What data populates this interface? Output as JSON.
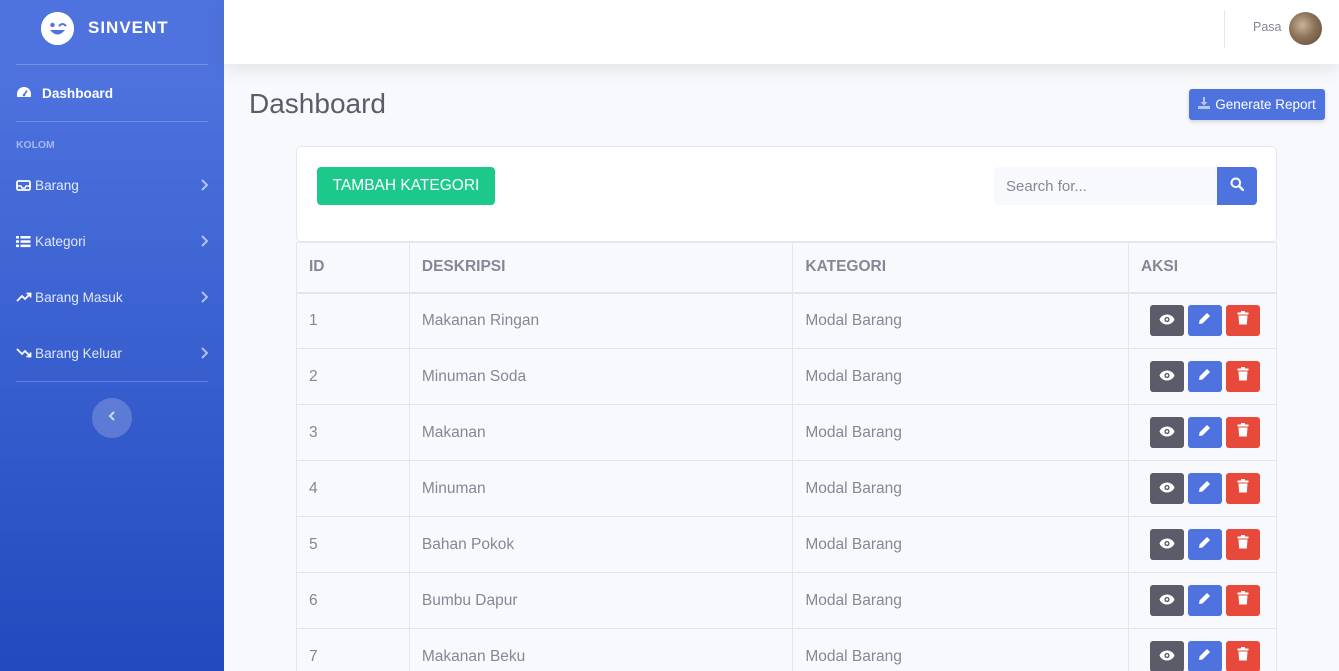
{
  "brand": {
    "name": "SINVENT",
    "icon": "laugh-wink-icon"
  },
  "sidebar": {
    "dashboard": {
      "label": "Dashboard",
      "icon": "tachometer-icon"
    },
    "heading": "KOLOM",
    "items": [
      {
        "label": "Barang",
        "icon": "inbox-icon"
      },
      {
        "label": "Kategori",
        "icon": "list-icon"
      },
      {
        "label": "Barang Masuk",
        "icon": "trend-up-icon"
      },
      {
        "label": "Barang Keluar",
        "icon": "trend-down-icon"
      }
    ],
    "toggle_icon": "chevron-left-icon"
  },
  "topbar": {
    "user_name": "Pasa"
  },
  "page": {
    "title": "Dashboard",
    "report_button": "Generate Report"
  },
  "card": {
    "add_button": "TAMBAH KATEGORI",
    "search_placeholder": "Search for..."
  },
  "table": {
    "headers": [
      "ID",
      "DESKRIPSI",
      "KATEGORI",
      "AKSI"
    ],
    "rows": [
      {
        "id": "1",
        "deskripsi": "Makanan Ringan",
        "kategori": "Modal Barang"
      },
      {
        "id": "2",
        "deskripsi": "Minuman Soda",
        "kategori": "Modal Barang"
      },
      {
        "id": "3",
        "deskripsi": "Makanan",
        "kategori": "Modal Barang"
      },
      {
        "id": "4",
        "deskripsi": "Minuman",
        "kategori": "Modal Barang"
      },
      {
        "id": "5",
        "deskripsi": "Bahan Pokok",
        "kategori": "Modal Barang"
      },
      {
        "id": "6",
        "deskripsi": "Bumbu Dapur",
        "kategori": "Modal Barang"
      },
      {
        "id": "7",
        "deskripsi": "Makanan Beku",
        "kategori": "Modal Barang"
      }
    ]
  },
  "colors": {
    "primary": "#4e73df",
    "success": "#1cc88a",
    "danger": "#e74a3b",
    "dark": "#5a5c69"
  }
}
